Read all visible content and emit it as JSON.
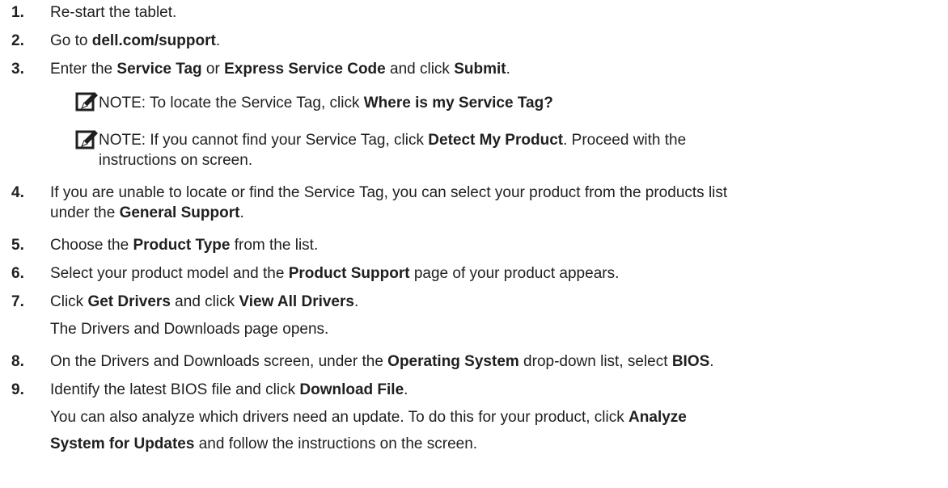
{
  "steps": [
    {
      "num": "1.",
      "parts": [
        "Re-start the tablet."
      ]
    },
    {
      "num": "2.",
      "parts": [
        "Go to ",
        "dell.com/support",
        "."
      ]
    },
    {
      "num": "3.",
      "parts": [
        "Enter the ",
        "Service Tag",
        " or ",
        "Express Service Code",
        " and click ",
        "Submit",
        "."
      ]
    },
    {
      "num": "4.",
      "line1": "If you are unable to locate or find the Service Tag, you can select your product from the products list",
      "line2": [
        "under the ",
        "General Support",
        "."
      ]
    },
    {
      "num": "5.",
      "parts": [
        "Choose the ",
        "Product Type",
        " from the list."
      ]
    },
    {
      "num": "6.",
      "parts": [
        "Select your product model and the ",
        "Product Support",
        " page of your product appears."
      ]
    },
    {
      "num": "7.",
      "parts": [
        "Click ",
        "Get Drivers",
        " and click ",
        "View All Drivers",
        "."
      ],
      "after": "The Drivers and Downloads page opens."
    },
    {
      "num": "8.",
      "parts": [
        "On the Drivers and Downloads screen, under the ",
        "Operating System",
        " drop-down list, select ",
        "BIOS",
        "."
      ]
    },
    {
      "num": "9.",
      "parts": [
        "Identify the latest BIOS file and click ",
        "Download File",
        "."
      ],
      "after1": [
        "You can also analyze which drivers need an update. To do this for your product, click ",
        "Analyze"
      ],
      "after2": [
        "System for Updates",
        " and follow the instructions on the screen."
      ]
    }
  ],
  "notes": [
    {
      "label": "NOTE:",
      "parts": [
        " To locate the Service Tag, click ",
        "Where is my Service Tag?"
      ]
    },
    {
      "label": "NOTE:",
      "parts": [
        " If you cannot find your Service Tag, click ",
        "Detect My Product",
        ". Proceed with the"
      ],
      "line2": "instructions on screen."
    }
  ],
  "icon": "note-pencil-icon"
}
